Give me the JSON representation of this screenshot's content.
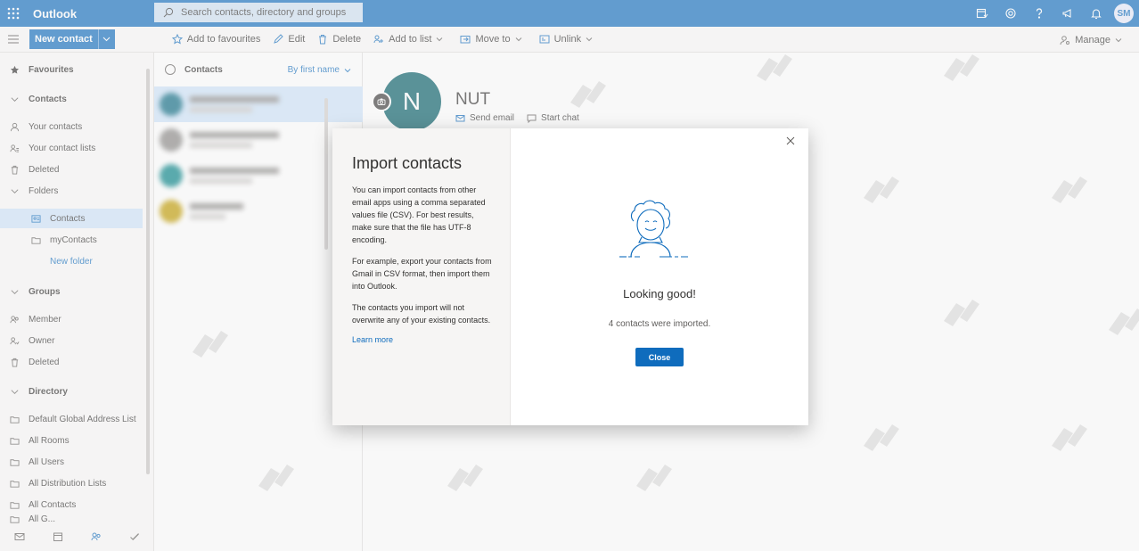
{
  "app": {
    "name": "Outlook"
  },
  "search": {
    "placeholder": "Search contacts, directory and groups"
  },
  "user": {
    "initials": "SM"
  },
  "toolbar": {
    "new_contact": "New contact",
    "add_to_favourites": "Add to favourites",
    "edit": "Edit",
    "delete": "Delete",
    "add_to_list": "Add to list",
    "move_to": "Move to",
    "unlink": "Unlink",
    "manage": "Manage"
  },
  "sidebar": {
    "favourites": "Favourites",
    "contacts_section": "Contacts",
    "your_contacts": "Your contacts",
    "your_contact_lists": "Your contact lists",
    "deleted": "Deleted",
    "folders": "Folders",
    "folder_contacts": "Contacts",
    "folder_mycontacts": "myContacts",
    "new_folder": "New folder",
    "groups": "Groups",
    "member": "Member",
    "owner": "Owner",
    "groups_deleted": "Deleted",
    "directory": "Directory",
    "default_gal": "Default Global Address List",
    "all_rooms": "All Rooms",
    "all_users": "All Users",
    "all_distribution_lists": "All Distribution Lists",
    "all_contacts": "All Contacts",
    "all_g": "All G..."
  },
  "contact_list": {
    "header": "Contacts",
    "sort": "By first name",
    "avatar_colors": [
      "#0b6a83",
      "#8a8886",
      "#038387",
      "#c19c00"
    ]
  },
  "detail": {
    "initial": "N",
    "name": "NUT",
    "send_email": "Send email",
    "start_chat": "Start chat",
    "avatar_color": "#035c67"
  },
  "dialog": {
    "title": "Import contacts",
    "p1": "You can import contacts from other email apps using a comma separated values file (CSV). For best results, make sure that the file has UTF-8 encoding.",
    "p2": "For example, export your contacts from Gmail in CSV format, then import them into Outlook.",
    "p3": "The contacts you import will not overwrite any of your existing contacts.",
    "learn_more": "Learn more",
    "status_title": "Looking good!",
    "status_text": "4 contacts were imported.",
    "close_button": "Close"
  },
  "colors": {
    "accent": "#0f6cbd",
    "selected": "#cfe4fa"
  }
}
